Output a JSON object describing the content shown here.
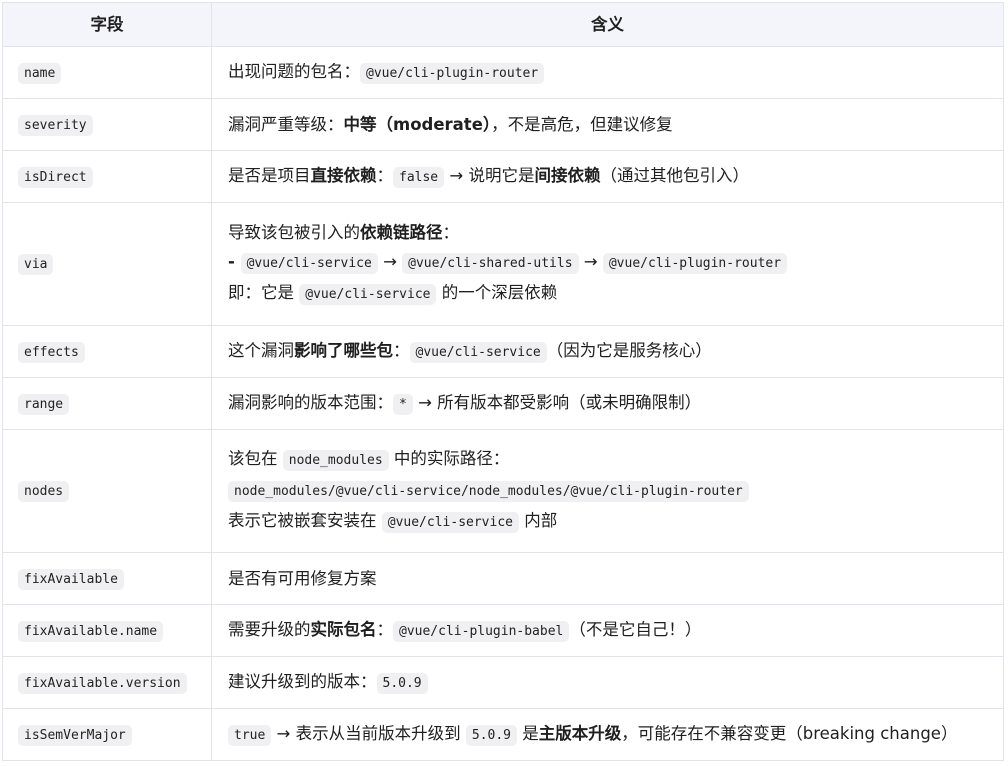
{
  "header": {
    "col1": "字段",
    "col2": "含义"
  },
  "rows": {
    "name": {
      "key": "name",
      "t1": "出现问题的包名：",
      "c1": "@vue/cli-plugin-router"
    },
    "severity": {
      "key": "severity",
      "t1": "漏洞严重等级：",
      "b1": "中等（moderate）",
      "t2": "，不是高危，但建议修复"
    },
    "isDirect": {
      "key": "isDirect",
      "t1": "是否是项目",
      "b1": "直接依赖",
      "t2": "：",
      "c1": "false",
      "t3": " → 说明它是",
      "b2": "间接依赖",
      "t4": "（通过其他包引入）"
    },
    "via": {
      "key": "via",
      "l1t1": "导致该包被引入的",
      "l1b1": "依赖链路径",
      "l1t2": "：",
      "l2t1": "- ",
      "l2c1": "@vue/cli-service",
      "l2a1": " → ",
      "l2c2": "@vue/cli-shared-utils",
      "l2a2": " → ",
      "l2c3": "@vue/cli-plugin-router",
      "l3t1": "即：它是 ",
      "l3c1": "@vue/cli-service",
      "l3t2": " 的一个深层依赖"
    },
    "effects": {
      "key": "effects",
      "t1": "这个漏洞",
      "b1": "影响了哪些包",
      "t2": "：",
      "c1": "@vue/cli-service",
      "t3": "（因为它是服务核心）"
    },
    "range": {
      "key": "range",
      "t1": "漏洞影响的版本范围：",
      "c1": "*",
      "t2": " → 所有版本都受影响（或未明确限制）"
    },
    "nodes": {
      "key": "nodes",
      "l1t1": "该包在 ",
      "l1c1": "node_modules",
      "l1t2": " 中的实际路径：",
      "l2c1": "node_modules/@vue/cli-service/node_modules/@vue/cli-plugin-router",
      "l3t1": "表示它被嵌套安装在 ",
      "l3c1": "@vue/cli-service",
      "l3t2": " 内部"
    },
    "fixAvailable": {
      "key": "fixAvailable",
      "t1": "是否有可用修复方案"
    },
    "fixAvailableName": {
      "key": "fixAvailable.name",
      "t1": "需要升级的",
      "b1": "实际包名",
      "t2": "：",
      "c1": "@vue/cli-plugin-babel",
      "t3": "（不是它自己！）"
    },
    "fixAvailableVersion": {
      "key": "fixAvailable.version",
      "t1": "建议升级到的版本：",
      "c1": "5.0.9"
    },
    "isSemVerMajor": {
      "key": "isSemVerMajor",
      "c1": "true",
      "t1": " → 表示从当前版本升级到 ",
      "c2": "5.0.9",
      "t2": " 是",
      "b1": "主版本升级",
      "t3": "，可能存在不兼容变更（breaking change）"
    }
  }
}
